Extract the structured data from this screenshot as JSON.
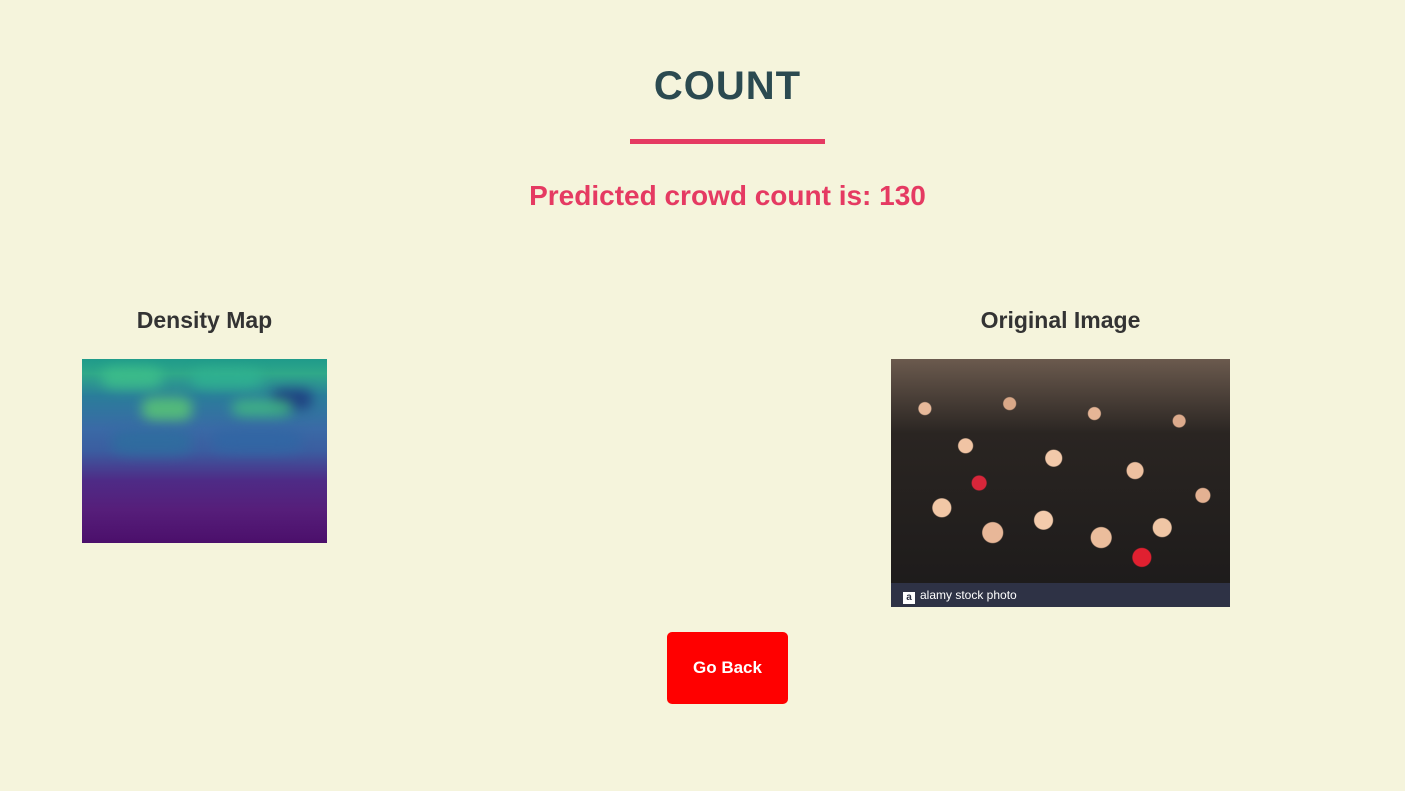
{
  "header": {
    "title": "COUNT"
  },
  "result": {
    "text": "Predicted crowd count is: 130",
    "count": 130
  },
  "panels": {
    "density_map": {
      "title": "Density Map"
    },
    "original_image": {
      "title": "Original Image",
      "watermark_label": "alamy stock photo",
      "watermark_badge": "a"
    }
  },
  "actions": {
    "go_back_label": "Go Back"
  },
  "colors": {
    "background": "#f5f4dc",
    "title": "#2b4a50",
    "accent": "#e53a62",
    "button": "#ff0000"
  }
}
